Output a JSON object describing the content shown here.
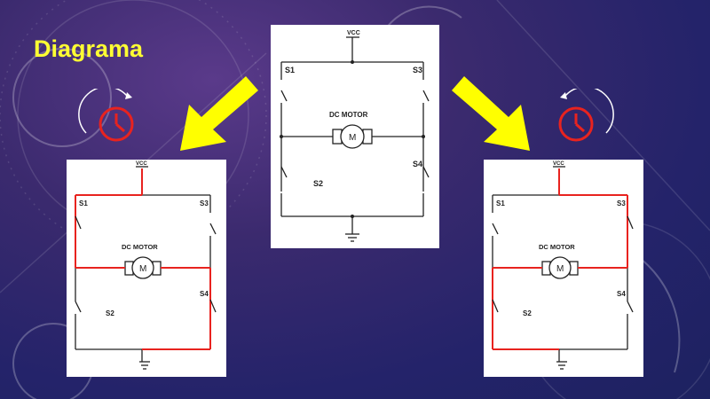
{
  "slide": {
    "title": "Diagrama"
  },
  "circuit": {
    "supply_label": "VCC",
    "motor_label": "DC MOTOR",
    "motor_symbol": "M",
    "switch_labels": {
      "s1": "S1",
      "s2": "S2",
      "s3": "S3",
      "s4": "S4"
    }
  },
  "left_panel": {
    "active_switches": [
      "S1",
      "S4"
    ],
    "highlight_color": "#e8231f"
  },
  "right_panel": {
    "active_switches": [
      "S3",
      "S2"
    ],
    "highlight_color": "#e8231f"
  },
  "icons": {
    "left_clock": "clockwise-clock-icon",
    "right_clock": "counterclockwise-clock-icon",
    "arrows": "yellow-arrow-icon"
  },
  "colors": {
    "title": "#ffff33",
    "arrow": "#ffff00",
    "clock": "#e8231f",
    "wire": "#222222"
  }
}
